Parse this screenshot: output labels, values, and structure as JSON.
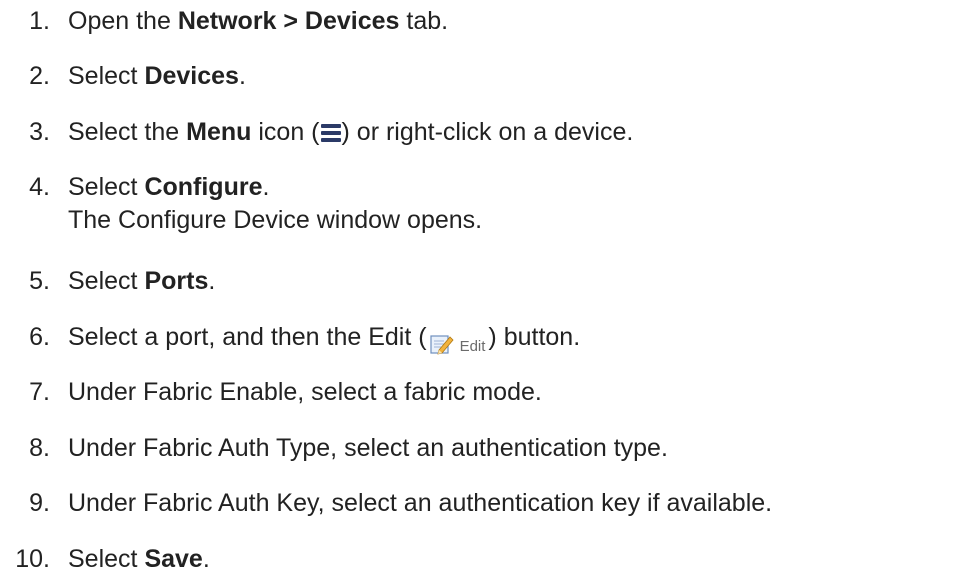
{
  "steps": [
    {
      "num": "1.",
      "pre": "Open the ",
      "bold": "Network > Devices",
      "post": " tab."
    },
    {
      "num": "2.",
      "pre": "Select ",
      "bold": "Devices",
      "post": "."
    },
    {
      "num": "3.",
      "pre": "Select the ",
      "bold": "Menu",
      "mid": " icon (",
      "icon": "hamburger-menu-icon",
      "post": ") or right-click on a device."
    },
    {
      "num": "4.",
      "pre": "Select ",
      "bold": "Configure",
      "post": ".",
      "line2": "The Configure Device window opens."
    },
    {
      "num": "5.",
      "pre": "Select ",
      "bold": "Ports",
      "post": "."
    },
    {
      "num": "6.",
      "pre": "Select a port, and then the Edit (",
      "icon": "edit-pencil-icon",
      "button_label": "Edit",
      "post": ") button."
    },
    {
      "num": "7.",
      "text": "Under Fabric Enable, select a fabric mode."
    },
    {
      "num": "8.",
      "text": "Under Fabric Auth Type, select an authentication type."
    },
    {
      "num": "9.",
      "text": "Under Fabric Auth Key, select an authentication key if available."
    },
    {
      "num": "10.",
      "pre": "Select ",
      "bold": "Save",
      "post": "."
    }
  ],
  "colors": {
    "text": "#222222",
    "menu_icon": "#2b3a67",
    "edit_label": "#6b6b6b"
  }
}
